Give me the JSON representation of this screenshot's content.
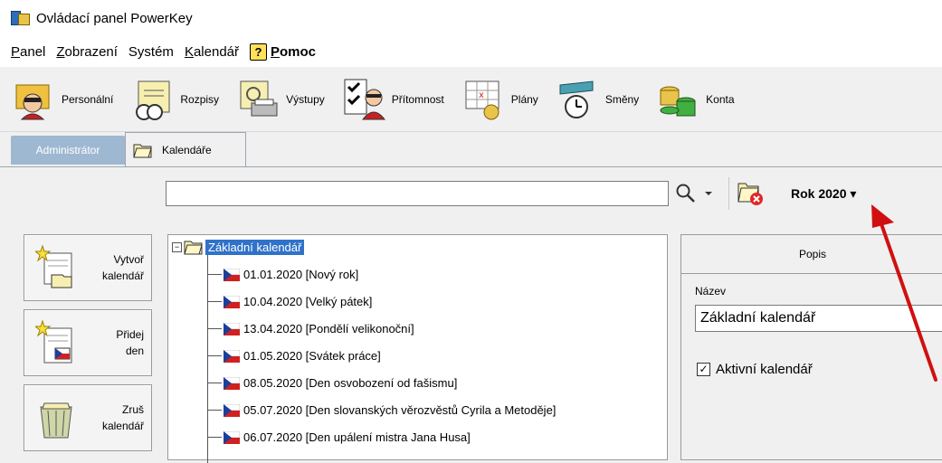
{
  "window": {
    "title": "Ovládací panel PowerKey"
  },
  "menu": {
    "items": [
      {
        "u": "P",
        "rest": "anel"
      },
      {
        "u": "Z",
        "rest": "obrazení"
      },
      {
        "u": "",
        "rest": "Systém"
      },
      {
        "u": "K",
        "rest": "alendář"
      }
    ],
    "help_icon": "?",
    "help_u": "P",
    "help_rest": "omoc"
  },
  "toolbar": {
    "buttons": [
      "Personální",
      "Rozpisy",
      "Výstupy",
      "Přítomnost",
      "Plány",
      "Směny",
      "Konta"
    ]
  },
  "tabs": {
    "admin": "Administrátor",
    "calendars": "Kalendáře"
  },
  "search": {
    "value": ""
  },
  "filter": {
    "year_label": "Rok 2020 ▾"
  },
  "actions": {
    "create_l1": "Vytvoř",
    "create_l2": "kalendář",
    "add_l1": "Přidej",
    "add_l2": "den",
    "delete_l1": "Zruš",
    "delete_l2": "kalendář"
  },
  "tree": {
    "root": "Základní kalendář",
    "items": [
      "01.01.2020 [Nový rok]",
      "10.04.2020 [Velký pátek]",
      "13.04.2020 [Pondělí velikonoční]",
      "01.05.2020 [Svátek práce]",
      "08.05.2020 [Den osvobození od fašismu]",
      "05.07.2020 [Den slovanských věrozvěstů Cyrila a Metoděje]",
      "06.07.2020 [Den upálení mistra Jana Husa]"
    ]
  },
  "details": {
    "tab": "Popis",
    "name_label": "Název",
    "name_value": "Základní kalendář",
    "active_label": "Aktivní kalendář",
    "active_checked": true
  },
  "colors": {
    "selection": "#3072c8",
    "annotation_arrow": "#d01010",
    "admin_tab": "#9fb8d2"
  }
}
